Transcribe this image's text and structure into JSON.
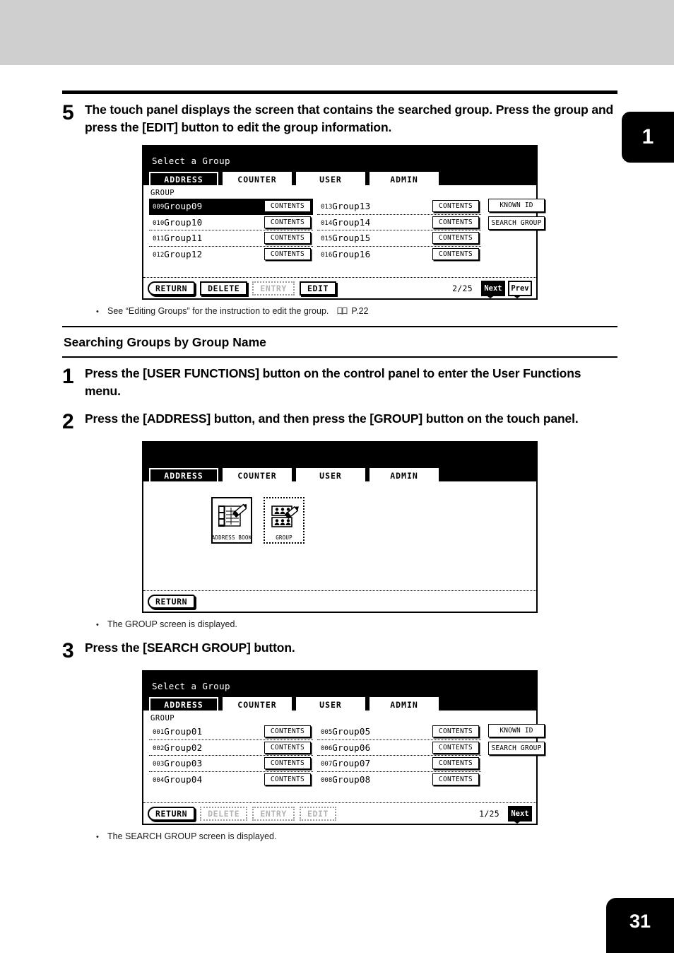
{
  "page": {
    "chapter_tab": "1",
    "page_number": "31"
  },
  "step5": {
    "number": "5",
    "text": "The touch panel displays the screen that contains the searched group.  Press the group and press the [EDIT] button to edit the group information."
  },
  "note_edit": {
    "bullet": "•",
    "text": "See “Editing Groups” for the instruction to edit the group.",
    "ref": "P.22",
    "icon": "book-icon"
  },
  "section": {
    "heading": "Searching Groups by Group Name"
  },
  "step1": {
    "number": "1",
    "text": "Press the [USER FUNCTIONS] button on the control panel to enter the User Functions menu."
  },
  "step2": {
    "number": "2",
    "text": "Press the [ADDRESS] button, and then press the [GROUP] button on the touch panel."
  },
  "note_group": {
    "bullet": "•",
    "text": "The GROUP screen is displayed."
  },
  "step3": {
    "number": "3",
    "text": "Press the [SEARCH GROUP] button."
  },
  "note_search": {
    "bullet": "•",
    "text": "The SEARCH GROUP screen is displayed."
  },
  "panel_common": {
    "title": "Select a Group",
    "group_label": "GROUP",
    "tabs": [
      {
        "label": "ADDRESS",
        "active": true
      },
      {
        "label": "COUNTER",
        "active": false
      },
      {
        "label": "USER",
        "active": false
      },
      {
        "label": "ADMIN",
        "active": false
      }
    ],
    "contents_label": "CONTENTS",
    "known_id_label": "KNOWN ID",
    "search_group_label": "SEARCH GROUP",
    "return_label": "RETURN",
    "delete_label": "DELETE",
    "entry_label": "ENTRY",
    "edit_label": "EDIT",
    "next_label": "Next",
    "prev_label": "Prev"
  },
  "panel_step5": {
    "title": "Select a Group",
    "group_label": "GROUP",
    "left_rows": [
      {
        "index": "009",
        "name": "Group09",
        "selected": true
      },
      {
        "index": "010",
        "name": "Group10",
        "selected": false
      },
      {
        "index": "011",
        "name": "Group11",
        "selected": false
      },
      {
        "index": "012",
        "name": "Group12",
        "selected": false
      }
    ],
    "right_rows": [
      {
        "index": "013",
        "name": "Group13",
        "selected": false
      },
      {
        "index": "014",
        "name": "Group14",
        "selected": false
      },
      {
        "index": "015",
        "name": "Group15",
        "selected": false
      },
      {
        "index": "016",
        "name": "Group16",
        "selected": false
      }
    ],
    "page_count": "2/25",
    "footer": {
      "return": "RETURN",
      "delete": "DELETE",
      "entry": "ENTRY",
      "edit": "EDIT",
      "next": "Next",
      "prev": "Prev"
    }
  },
  "panel_step2": {
    "title": "",
    "icons": [
      {
        "label": "ADDRESS BOOK",
        "icon": "address-book-icon"
      },
      {
        "label": "GROUP",
        "icon": "group-icon"
      }
    ],
    "return_label": "RETURN"
  },
  "panel_step3": {
    "title": "Select a Group",
    "group_label": "GROUP",
    "left_rows": [
      {
        "index": "001",
        "name": "Group01",
        "selected": false
      },
      {
        "index": "002",
        "name": "Group02",
        "selected": false
      },
      {
        "index": "003",
        "name": "Group03",
        "selected": false
      },
      {
        "index": "004",
        "name": "Group04",
        "selected": false
      }
    ],
    "right_rows": [
      {
        "index": "005",
        "name": "Group05",
        "selected": false
      },
      {
        "index": "006",
        "name": "Group06",
        "selected": false
      },
      {
        "index": "007",
        "name": "Group07",
        "selected": false
      },
      {
        "index": "008",
        "name": "Group08",
        "selected": false
      }
    ],
    "page_count": "1/25",
    "footer": {
      "return": "RETURN",
      "delete": "DELETE",
      "entry": "ENTRY",
      "edit": "EDIT",
      "next": "Next"
    }
  },
  "colors": {
    "header_band": "#cfcfcf",
    "ink": "#000000",
    "paper": "#ffffff"
  }
}
